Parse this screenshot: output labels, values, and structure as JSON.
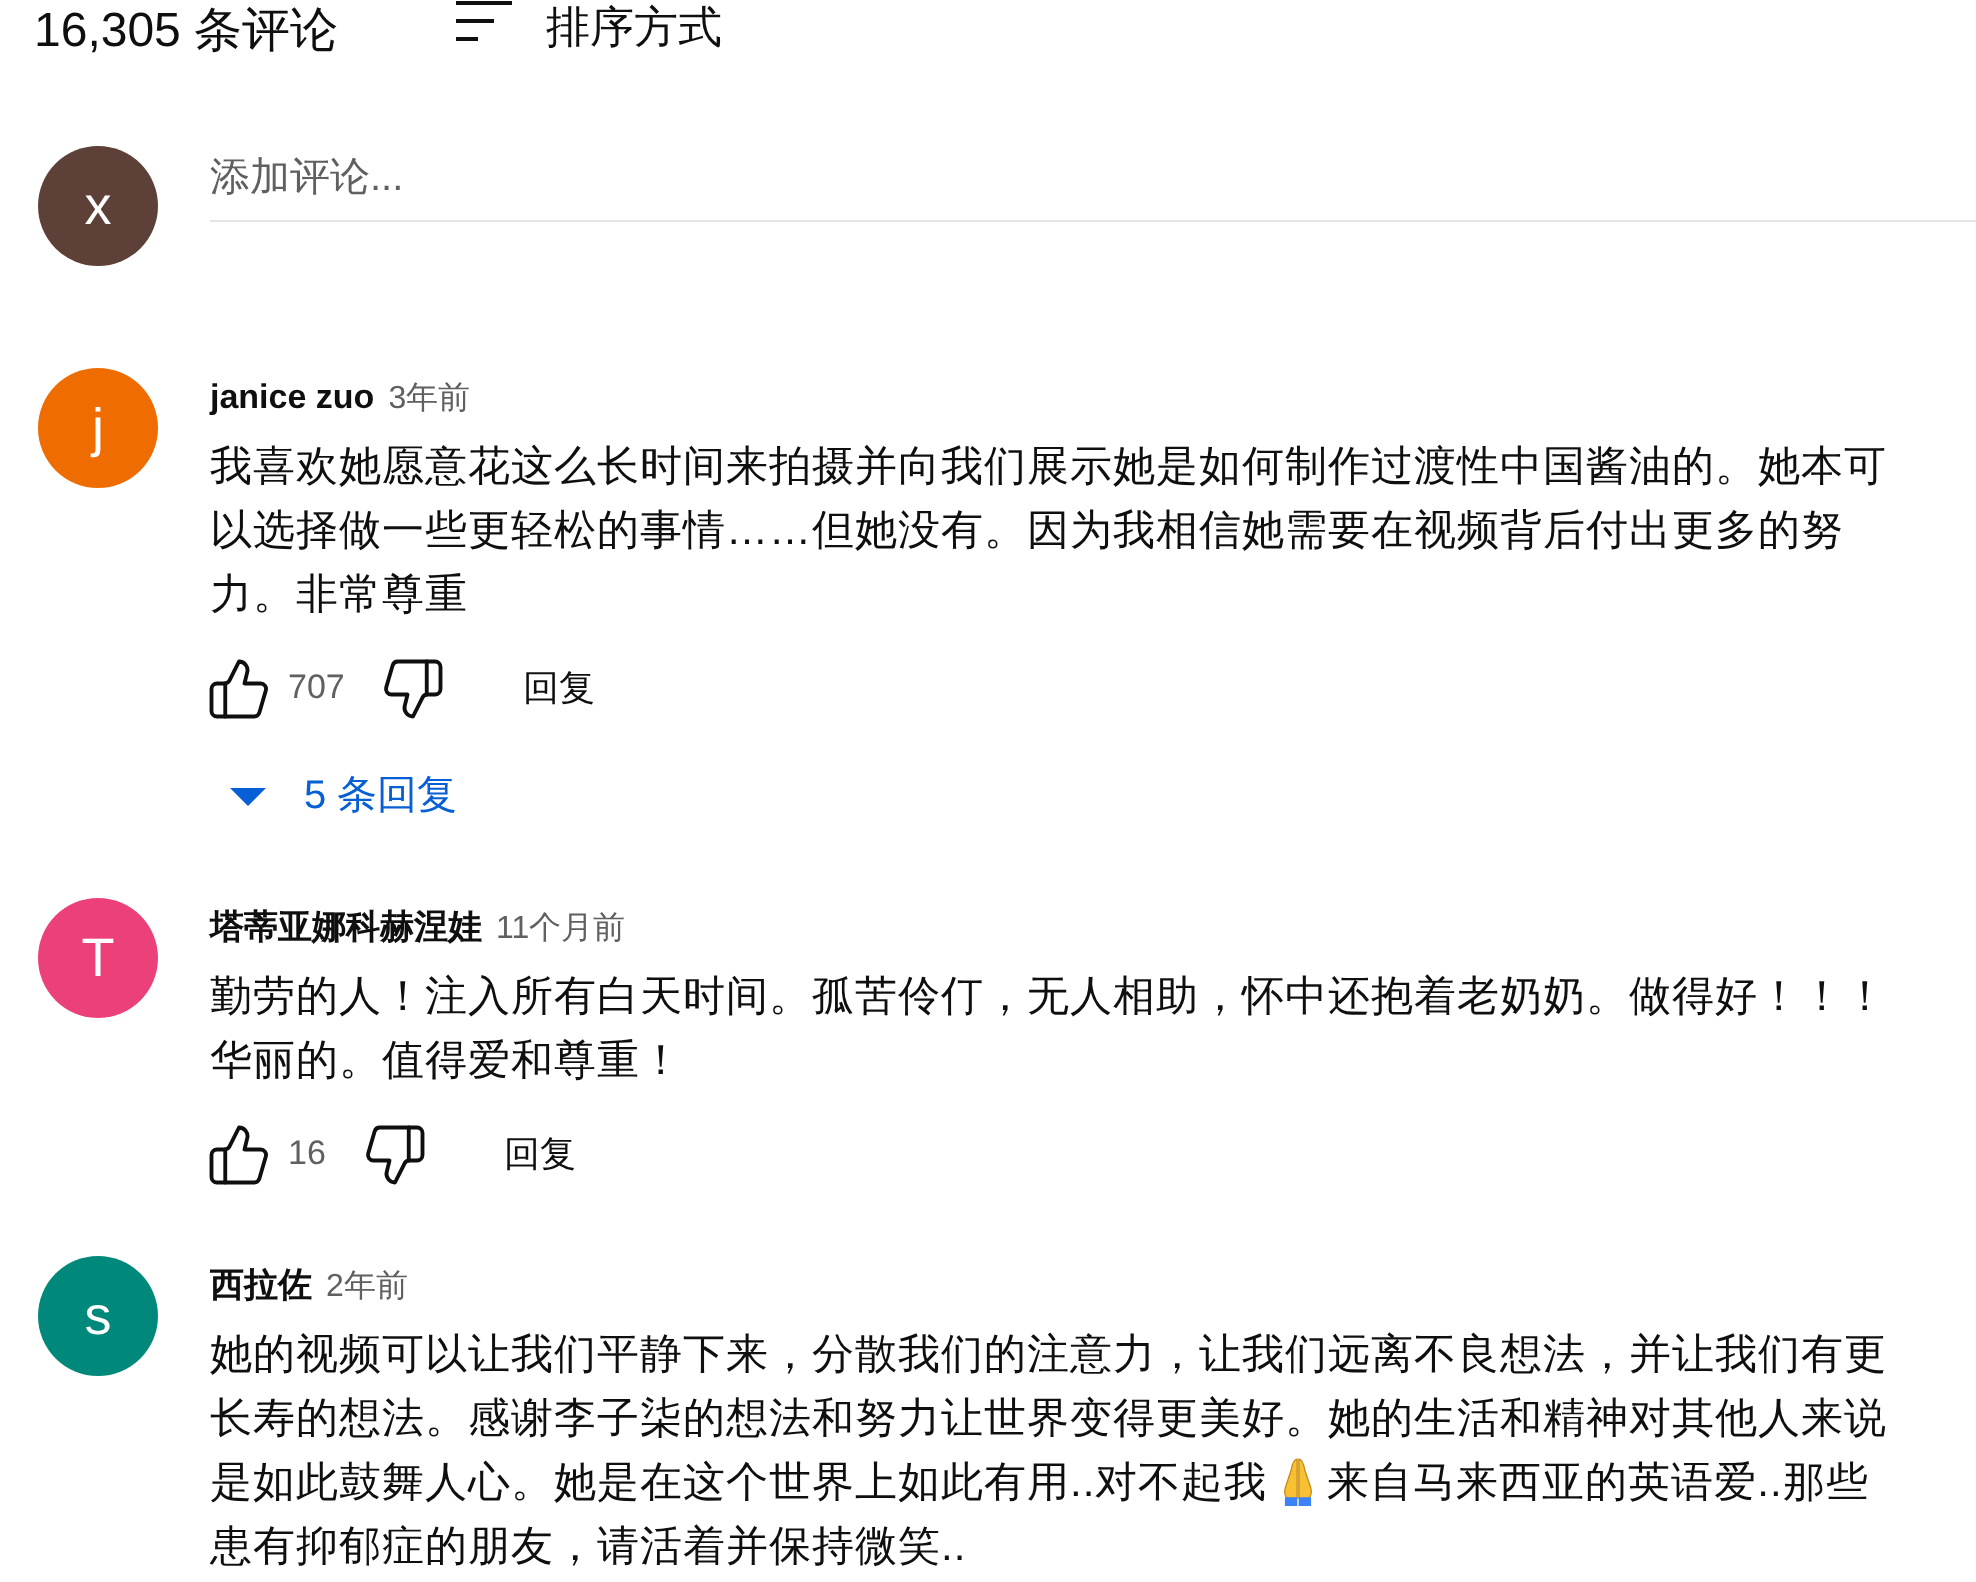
{
  "header": {
    "comment_count": "16,305 条评论",
    "sort_label": "排序方式"
  },
  "composer": {
    "avatar_letter": "x",
    "color": "#5d4037",
    "placeholder": "添加评论..."
  },
  "comments": [
    {
      "avatar_letter": "j",
      "color": "#ef6c00",
      "author": "janice zuo",
      "time": "3年前",
      "body": [
        {
          "kind": "text",
          "text": "我喜欢她愿意花这么长时间来拍摄并向我们展示她是如何制作过渡性中国酱油的。她本可以选择做一些更轻松的事情……但她没有。因为我相信她需要在视频背后付出更多的努力。非常尊重"
        }
      ],
      "actions": {
        "likes": "707",
        "reply_label": "回复"
      },
      "replies": {
        "label": "5 条回复",
        "expanded": false
      }
    },
    {
      "avatar_letter": "T",
      "color": "#ec407a",
      "author": "塔蒂亚娜科赫涅娃",
      "time": "11个月前",
      "body": [
        {
          "kind": "text",
          "text": "勤劳的人！注入所有白天时间。孤苦伶仃，无人相助，怀中还抱着老奶奶。做得好！！！华丽的。值得爱和尊重！"
        }
      ],
      "actions": {
        "likes": "16",
        "reply_label": "回复"
      }
    },
    {
      "avatar_letter": "s",
      "color": "#00897b",
      "author": "西拉佐",
      "time": "2年前",
      "body": [
        {
          "kind": "text",
          "text": "她的视频可以让我们平静下来，分散我们的注意力，让我们远离不良想法，并让我们有更长寿的想法。感谢李子柒的想法和努力让世界变得更美好。她的生活和精神对其他人来说是如此鼓舞人心。她是在这个世界上如此有用..对不起我"
        },
        {
          "kind": "emoji"
        },
        {
          "kind": "text",
          "text": "来自马来西亚的英语爱..那些患有抑郁症的朋友，请活着并保持微笑.."
        }
      ]
    }
  ]
}
